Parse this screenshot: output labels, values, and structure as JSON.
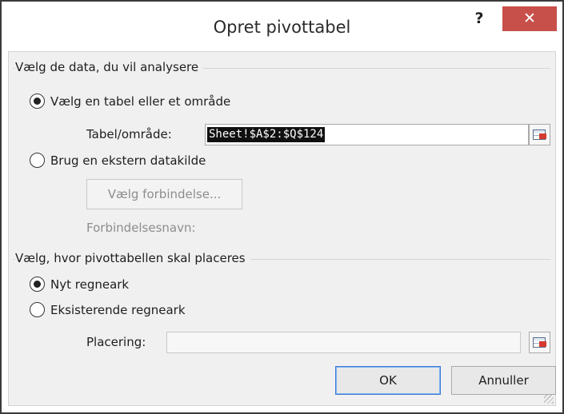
{
  "window": {
    "title": "Opret pivottabel",
    "help_label": "?",
    "close_label": "✕"
  },
  "data_group": {
    "label": "Vælg de data, du vil analysere",
    "radio_table_label": "Vælg en tabel eller et område",
    "range_label": "Tabel/område:",
    "range_value": "Sheet!$A$2:$Q$124",
    "radio_external_label": "Brug en ekstern datakilde",
    "choose_connection_label": "Vælg forbindelse...",
    "connection_name_label": "Forbindelsesnavn:"
  },
  "placement_group": {
    "label": "Vælg, hvor pivottabellen skal placeres",
    "radio_new_label": "Nyt regneark",
    "radio_existing_label": "Eksisterende regneark",
    "location_label": "Placering:",
    "location_value": ""
  },
  "buttons": {
    "ok_label": "OK",
    "cancel_label": "Annuller"
  },
  "state": {
    "data_source": "table",
    "placement": "new"
  },
  "icons": {
    "range_picker": "range-picker-icon",
    "location_picker": "location-picker-icon"
  }
}
